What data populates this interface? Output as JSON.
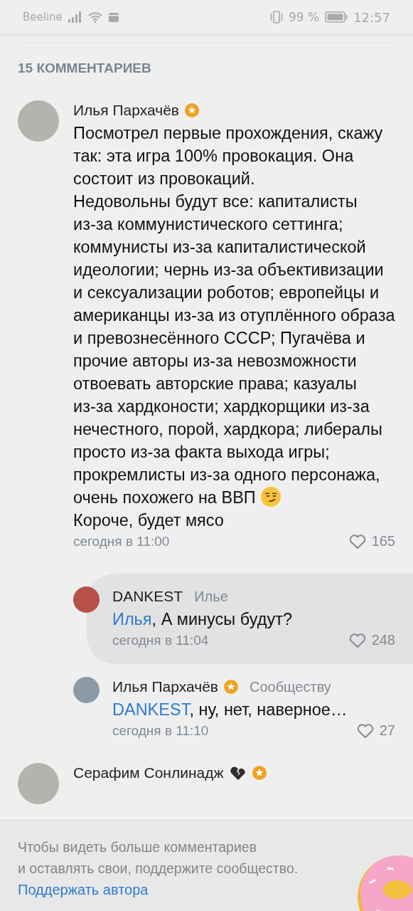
{
  "status_bar": {
    "carrier": "Beeline",
    "battery": "99 %",
    "time": "12:57"
  },
  "comments_header": "15 КОММЕНТАРИЕВ",
  "comments": [
    {
      "author": "Илья Пархачёв",
      "badge": true,
      "nested": false,
      "highlighted": false,
      "paragraphs": [
        {
          "text": "Посмотрел первые прохождения, скажу так: эта игра 100% провокация. Она состоит из провокаций.",
          "emoji": false
        },
        {
          "text": "Недовольны будут все: капиталисты из‑за коммунистического сеттинга; коммунисты из‑за капиталистической идеологии;  чернь из‑за объективизации и сексуализации роботов; европейцы и американцы из‑за из отуплённого образа и превознесённого СССР; Пугачёва и прочие авторы из‑за невозможности отвоевать авторские права; казуалы из‑за хардконости; хардкорщики из‑за нечестного, порой, хардкора; либералы просто из‑за факта выхода игры; прокремлисты из‑за одного персонажа, очень похожего на ВВП",
          "emoji": true
        },
        {
          "text": "Короче, будет мясо",
          "emoji": false
        }
      ],
      "time": "сегодня в 11:00",
      "likes": "165"
    },
    {
      "author": "DANKEST",
      "badge": false,
      "reply_to": "Илье",
      "nested": true,
      "highlighted": true,
      "mention": "Илья",
      "paragraphs": [
        {
          "text": ", А минусы будут?",
          "emoji": false
        }
      ],
      "time": "сегодня в 11:04",
      "likes": "248"
    },
    {
      "author": "Илья Пархачёв",
      "badge": true,
      "reply_to": "Сообществу",
      "nested": true,
      "highlighted": false,
      "mention": "DANKEST",
      "paragraphs": [
        {
          "text": ", ну, нет, наверное…",
          "emoji": false
        }
      ],
      "time": "сегодня в 11:10",
      "likes": "27"
    },
    {
      "author": "Серафим Сонлинадж",
      "badge": true,
      "broken_heart": true,
      "nested": false,
      "highlighted": false
    }
  ],
  "paywall": {
    "text": "Чтобы видеть больше комментариев\nи оставлять свои, поддержите сообщество.",
    "link": "Поддержать автора"
  }
}
